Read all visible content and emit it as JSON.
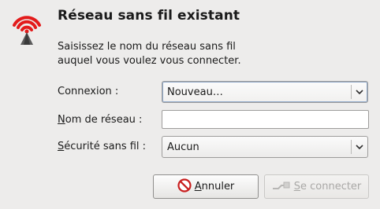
{
  "dialog": {
    "title": "Réseau sans fil existant",
    "description_line1": "Saisissez le nom du réseau sans fil",
    "description_line2": "auquel vous voulez vous connecter."
  },
  "form": {
    "connection": {
      "label": "Connexion :",
      "value": "Nouveau…"
    },
    "network_name": {
      "label_mnemonic": "N",
      "label_rest": "om de réseau :",
      "value": "",
      "placeholder": ""
    },
    "security": {
      "label_mnemonic": "S",
      "label_rest": "écurité sans fil :",
      "value": "Aucun"
    }
  },
  "buttons": {
    "cancel": {
      "mnemonic": "A",
      "rest": "nnuler",
      "icon": "cancel-icon"
    },
    "connect": {
      "mnemonic": "S",
      "rest": "e connecter",
      "icon": "connect-icon",
      "enabled": false
    }
  },
  "icons": {
    "header": "wireless-network-icon"
  },
  "colors": {
    "signal": "#e31b1b",
    "background": "#edeceb",
    "disabled_text": "#a9a8a6"
  }
}
